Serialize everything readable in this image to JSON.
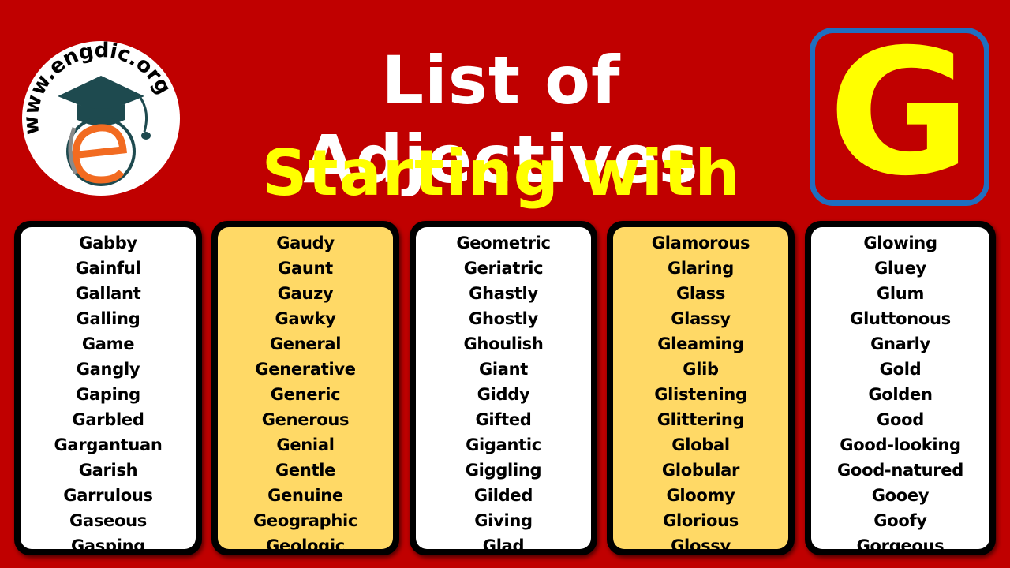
{
  "logo": {
    "url_text": "www.engdic.org",
    "icon": "graduation-cap-e-icon",
    "colors": {
      "cap": "#1e4a4f",
      "e": "#f26b21"
    }
  },
  "header": {
    "title_line1": "List of Adjectives",
    "title_line2": "Starting with",
    "letter": "G",
    "colors": {
      "line1": "#ffffff",
      "line2": "#ffff00",
      "letter": "#ffff00",
      "letter_border": "#1f6fc0",
      "background": "#c00000"
    }
  },
  "columns": [
    {
      "style": "white",
      "words": [
        "Gabby",
        "Gainful",
        "Gallant",
        "Galling",
        "Game",
        "Gangly",
        "Gaping",
        "Garbled",
        "Gargantuan",
        "Garish",
        "Garrulous",
        "Gaseous",
        "Gasping"
      ]
    },
    {
      "style": "yellow",
      "words": [
        "Gaudy",
        "Gaunt",
        "Gauzy",
        "Gawky",
        "General",
        "Generative",
        "Generic",
        "Generous",
        "Genial",
        "Gentle",
        "Genuine",
        "Geographic",
        "Geologic"
      ]
    },
    {
      "style": "white",
      "words": [
        "Geometric",
        "Geriatric",
        "Ghastly",
        "Ghostly",
        "Ghoulish",
        "Giant",
        "Giddy",
        "Gifted",
        "Gigantic",
        "Giggling",
        "Gilded",
        "Giving",
        "Glad"
      ]
    },
    {
      "style": "yellow",
      "words": [
        "Glamorous",
        "Glaring",
        "Glass",
        "Glassy",
        "Gleaming",
        "Glib",
        "Glistening",
        "Glittering",
        "Global",
        "Globular",
        "Gloomy",
        "Glorious",
        "Glossy"
      ]
    },
    {
      "style": "white",
      "words": [
        "Glowing",
        "Gluey",
        "Glum",
        "Gluttonous",
        "Gnarly",
        "Gold",
        "Golden",
        "Good",
        "Good-looking",
        "Good-natured",
        "Gooey",
        "Goofy",
        "Gorgeous"
      ]
    }
  ]
}
